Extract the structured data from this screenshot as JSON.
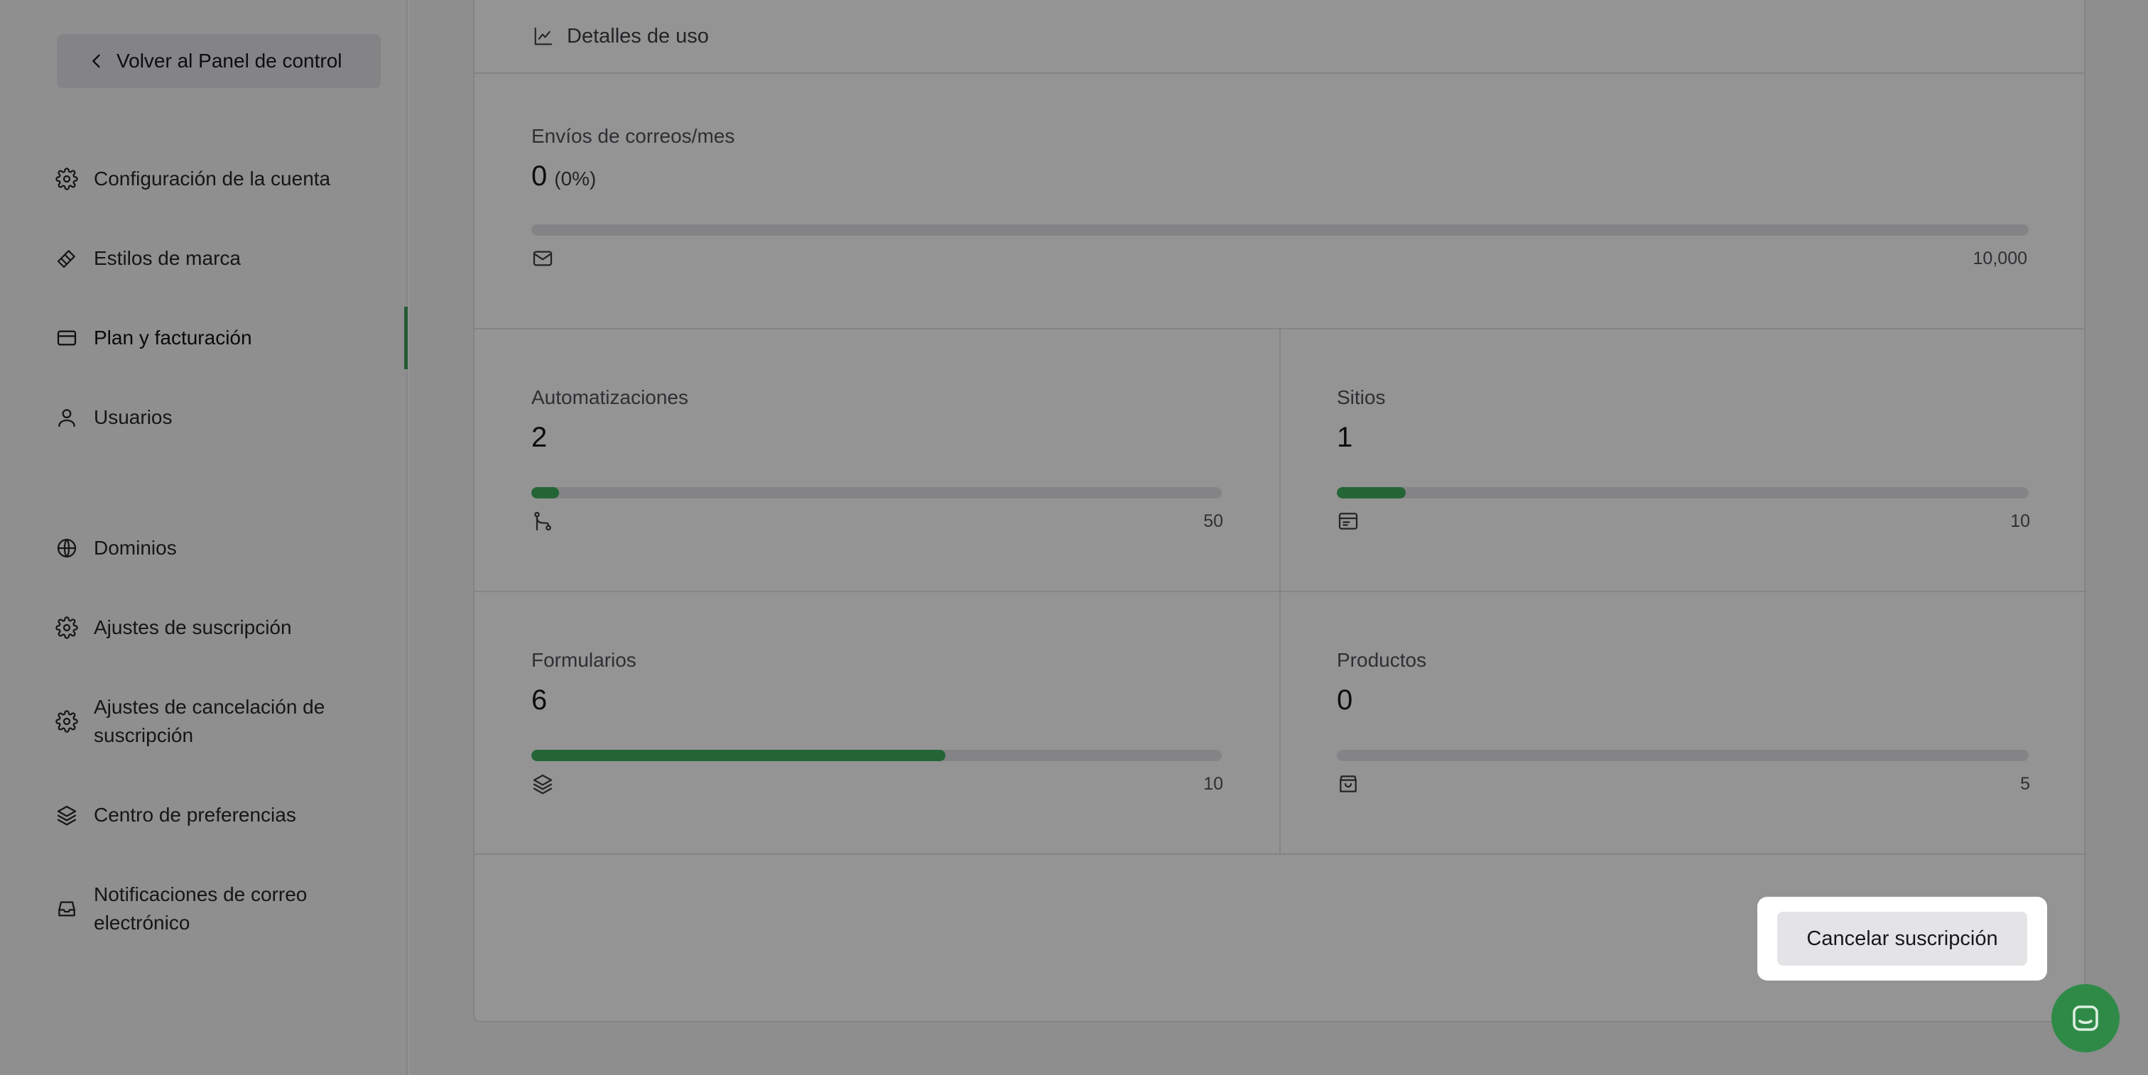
{
  "sidebar": {
    "back_label": "Volver al Panel de control",
    "items": [
      {
        "label": "Configuración de la cuenta",
        "icon": "gear-icon"
      },
      {
        "label": "Estilos de marca",
        "icon": "paint-brush-icon"
      },
      {
        "label": "Plan y facturación",
        "icon": "credit-card-icon",
        "active": true
      },
      {
        "label": "Usuarios",
        "icon": "user-icon"
      },
      {
        "label": "Dominios",
        "icon": "globe-icon"
      },
      {
        "label": "Ajustes de suscripción",
        "icon": "gear-icon"
      },
      {
        "label": "Ajustes de cancelación de suscripción",
        "icon": "gear-icon"
      },
      {
        "label": "Centro de preferencias",
        "icon": "layers-icon"
      },
      {
        "label": "Notificaciones de correo electrónico",
        "icon": "inbox-icon"
      }
    ]
  },
  "usage": {
    "title": "Detalles de uso",
    "emails": {
      "label": "Envíos de correos/mes",
      "value": "0",
      "percent": "(0%)",
      "limit": "10,000",
      "fraction": 0
    },
    "automations": {
      "label": "Automatizaciones",
      "value": "2",
      "limit": "50",
      "fraction": 0.04
    },
    "sites": {
      "label": "Sitios",
      "value": "1",
      "limit": "10",
      "fraction": 0.1
    },
    "forms": {
      "label": "Formularios",
      "value": "6",
      "limit": "10",
      "fraction": 0.6
    },
    "products": {
      "label": "Productos",
      "value": "0",
      "limit": "5",
      "fraction": 0
    }
  },
  "actions": {
    "cancel_label": "Cancelar suscripción"
  },
  "colors": {
    "accent": "#3fae5d",
    "active_indicator": "#3f9d57",
    "chat_button": "#2f8a48"
  }
}
